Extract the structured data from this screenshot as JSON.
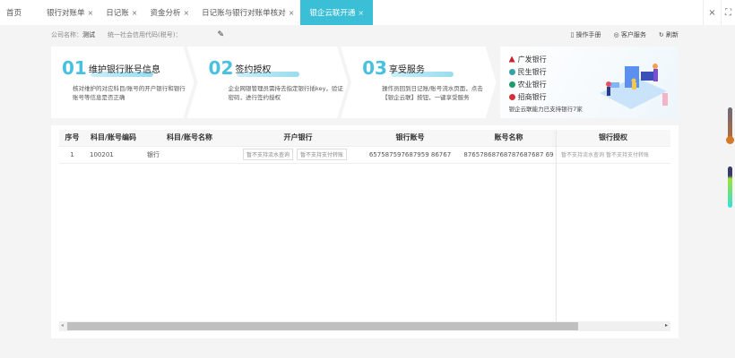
{
  "tabs": [
    {
      "label": "首页",
      "closable": false
    },
    {
      "label": "银行对账单",
      "closable": true
    },
    {
      "label": "日记账",
      "closable": true
    },
    {
      "label": "资金分析",
      "closable": true
    },
    {
      "label": "日记账与银行对账单核对",
      "closable": true
    },
    {
      "label": "银企云联开通",
      "closable": true,
      "active": true
    }
  ],
  "window": {
    "close": "×",
    "fullscreen": "⛶"
  },
  "info": {
    "company_label": "公司名称：",
    "company_value": "测试",
    "credit_label": "统一社会信用代码(税号)：",
    "edit_icon": "✎",
    "manual": "操作手册",
    "service": "客户服务",
    "refresh": "刷新"
  },
  "steps": [
    {
      "num": "01",
      "title": "维护银行账号信息",
      "desc": "核对维护的对应科目/账号的开户银行和银行账号等信息是否正确"
    },
    {
      "num": "02",
      "title": "签约授权",
      "desc": "企业网银管理员需持去指定银行插key，验证密码，进行签约授权"
    },
    {
      "num": "03",
      "title": "享受服务",
      "desc": "操作员回到日记账/账号流水页面，点击【银企云联】按钮，一键享受服务"
    }
  ],
  "banks": {
    "items": [
      {
        "name": "广发银行",
        "color": "#c8242f"
      },
      {
        "name": "民生银行",
        "color": "#3aa0a8"
      },
      {
        "name": "农业银行",
        "color": "#1e9a6b"
      },
      {
        "name": "招商银行",
        "color": "#d0343a"
      }
    ],
    "footer": "银企云联能力已支持银行7家"
  },
  "table": {
    "columns": [
      "序号",
      "科目/账号编码",
      "科目/账号名称",
      "开户银行",
      "银行账号",
      "账号名称",
      "银行授权"
    ],
    "rows": [
      {
        "index": "1",
        "code": "100201",
        "name": "银行",
        "bank_tags": [
          "暂不支持流水查询",
          "暂不支持支付转账"
        ],
        "account": "657587597687959 86767",
        "account_name": "87657868768787687687 69",
        "auth_tags": [
          "暂不支持流水查询",
          "暂不支持支付转账"
        ]
      }
    ]
  },
  "colors": {
    "accent": "#3bbfd6",
    "step_number": "#49c1de"
  }
}
